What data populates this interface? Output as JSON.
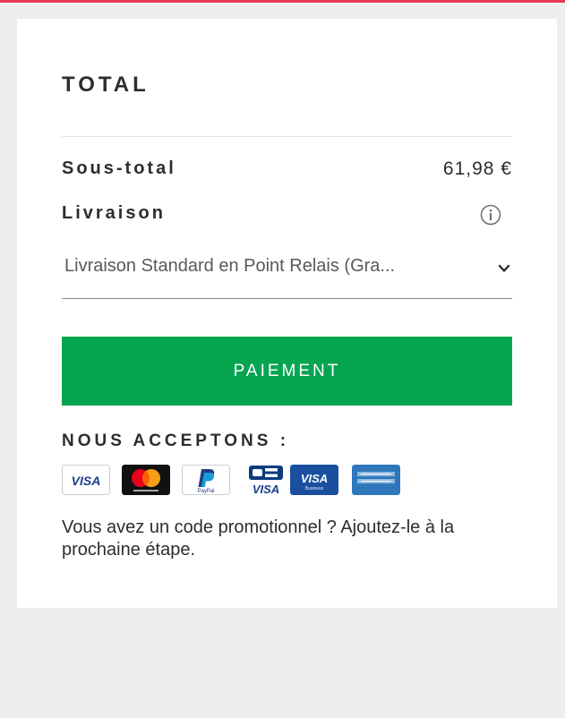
{
  "summary": {
    "title": "TOTAL",
    "subtotal_label": "Sous-total",
    "subtotal_value": "61,98 €",
    "delivery_label": "Livraison",
    "delivery_option": "Livraison Standard en Point Relais (Gra...",
    "pay_button_label": "PAIEMENT",
    "accept_title": "NOUS ACCEPTONS :",
    "payment_methods": [
      "visa-icon",
      "mastercard-icon",
      "paypal-icon",
      "carte-bancaire-icon",
      "visa-business-icon",
      "american-express-icon"
    ],
    "payment_logo_texts": {
      "visa": "VISA",
      "paypal": "PayPal",
      "cb_visa": "VISA",
      "visa_business": "VISA",
      "visa_business_sub": "Business"
    },
    "promo_text": "Vous avez un code promotionnel ? Ajoutez-le à la prochaine étape."
  },
  "colors": {
    "accent_bar": "#e8375a",
    "pay_button": "#05a550",
    "page_background": "#eeeeee",
    "card_background": "#ffffff"
  }
}
